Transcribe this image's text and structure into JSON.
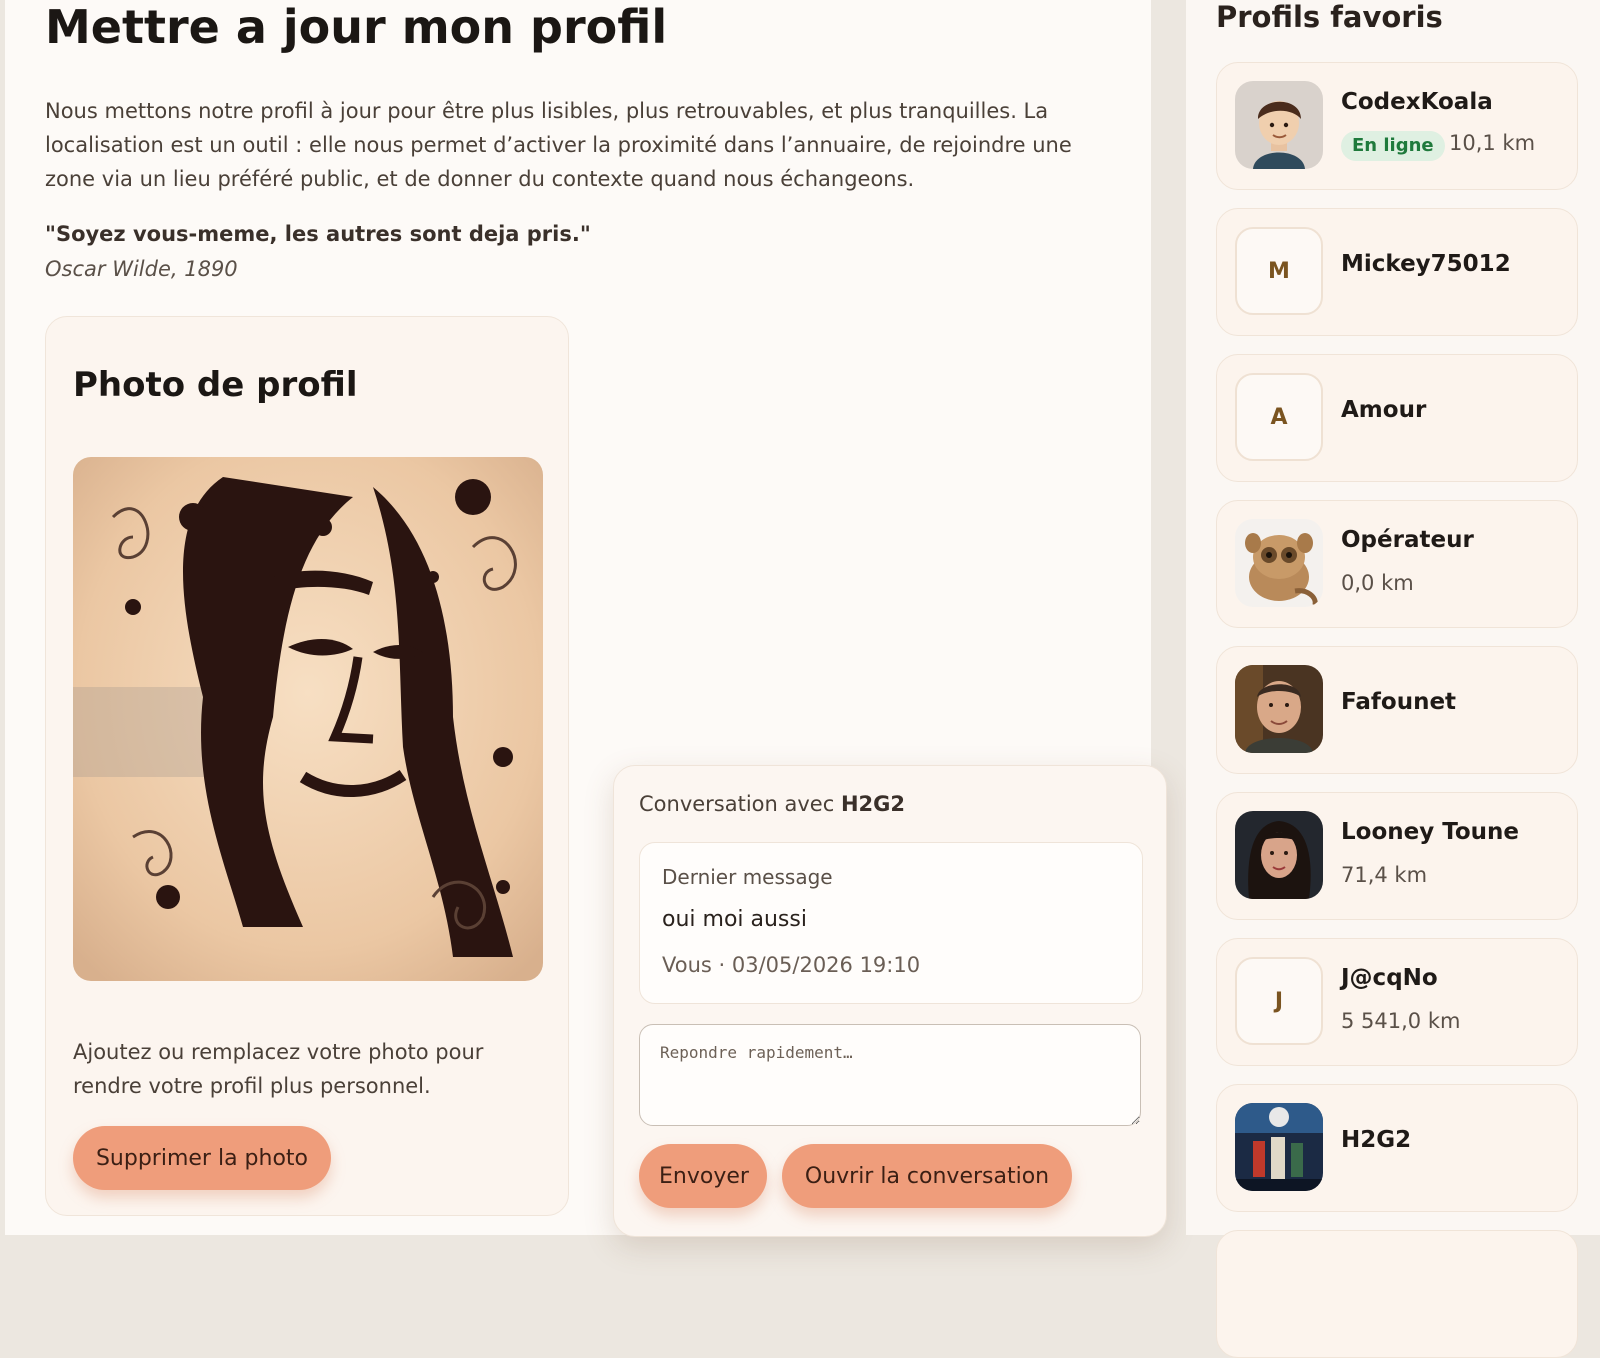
{
  "page": {
    "title": "Mettre a jour mon profil",
    "intro": "Nous mettons notre profil à jour pour être plus lisibles, plus retrouvables, et plus tranquilles. La localisation est un outil : elle nous permet d’activer la proximité dans l’annuaire, de rejoindre une zone via un lieu préféré public, et de donner du contexte quand nous échangeons.",
    "quote": "\"Soyez vous-meme, les autres sont deja pris.\"",
    "quote_author": "Oscar Wilde, 1890"
  },
  "photo_card": {
    "title": "Photo de profil",
    "help": "Ajoutez ou remplacez votre photo pour rendre votre profil plus personnel.",
    "delete_label": "Supprimer la photo"
  },
  "conversation": {
    "title_prefix": "Conversation avec ",
    "contact": "H2G2",
    "last_message_label": "Dernier message",
    "last_message": "oui moi aussi",
    "meta": "Vous · 03/05/2026 19:10",
    "reply_placeholder": "Repondre rapidement…",
    "send_label": "Envoyer",
    "open_label": "Ouvrir la conversation"
  },
  "favorites": {
    "title": "Profils favoris",
    "items": [
      {
        "name": "CodexKoala",
        "badge": "En ligne",
        "distance": "10,1 km",
        "avatar": "cartoon-avatar"
      },
      {
        "name": "Mickey75012",
        "letter": "M",
        "avatar": "letter-avatar"
      },
      {
        "name": "Amour",
        "letter": "A",
        "avatar": "letter-avatar"
      },
      {
        "name": "Opérateur",
        "distance": "0,0 km",
        "avatar": "tarsier-photo"
      },
      {
        "name": "Fafounet",
        "avatar": "man-photo"
      },
      {
        "name": "Looney Toune",
        "distance": "71,4 km",
        "avatar": "woman-photo"
      },
      {
        "name": "J@cqNo",
        "letter": "J",
        "distance": "5 541,0 km",
        "avatar": "letter-avatar"
      },
      {
        "name": "H2G2",
        "avatar": "movie-poster"
      }
    ]
  },
  "colors": {
    "accent_button": "#ef9d7b",
    "online_badge_bg": "#dff0e2",
    "online_badge_text": "#1f7a3c",
    "card_bg": "#fcf4ed"
  }
}
